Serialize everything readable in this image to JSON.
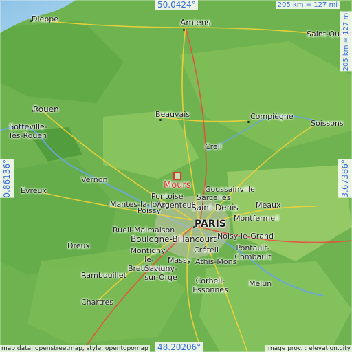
{
  "map": {
    "coords": {
      "top": "50.0424°",
      "bottom": "48.20206°",
      "left": "0.86136°",
      "right": "3.67386°"
    },
    "scales": {
      "horizontal": "205 km = 127 mi",
      "vertical": "205 km = 127 mi"
    },
    "credits": {
      "left": "map data: openstreetmap, style: opentopomap",
      "right": "image prov. : elevation.city"
    },
    "places": [
      {
        "name": "Dieppe"
      },
      {
        "name": "Amiens"
      },
      {
        "name": "Saint-Quentin"
      },
      {
        "name": "Rouen"
      },
      {
        "name": "Sotteville-lès-Rouen"
      },
      {
        "name": "Beauvais"
      },
      {
        "name": "Compiègne"
      },
      {
        "name": "Soissons"
      },
      {
        "name": "Creil"
      },
      {
        "name": "Vernon"
      },
      {
        "name": "Évreux"
      },
      {
        "name": "Mours"
      },
      {
        "name": "Goussainville"
      },
      {
        "name": "Pontoise"
      },
      {
        "name": "Sarcelles"
      },
      {
        "name": "Mantes-la-Jolie"
      },
      {
        "name": "Argenteuil"
      },
      {
        "name": "Saint-Denis"
      },
      {
        "name": "Meaux"
      },
      {
        "name": "Poissy"
      },
      {
        "name": "Montfermeil"
      },
      {
        "name": "PARIS"
      },
      {
        "name": "Rueil-Malmaison"
      },
      {
        "name": "Boulogne-Billancourt"
      },
      {
        "name": "Noisy-le-Grand"
      },
      {
        "name": "Dreux"
      },
      {
        "name": "Montigny-le-Bretonneux"
      },
      {
        "name": "Créteil"
      },
      {
        "name": "Pontault-Combault"
      },
      {
        "name": "Massy"
      },
      {
        "name": "Athis-Mons"
      },
      {
        "name": "Savigny-sur-Orge"
      },
      {
        "name": "Rambouillet"
      },
      {
        "name": "Corbeil-Essonnes"
      },
      {
        "name": "Melun"
      },
      {
        "name": "Chartres"
      }
    ]
  }
}
